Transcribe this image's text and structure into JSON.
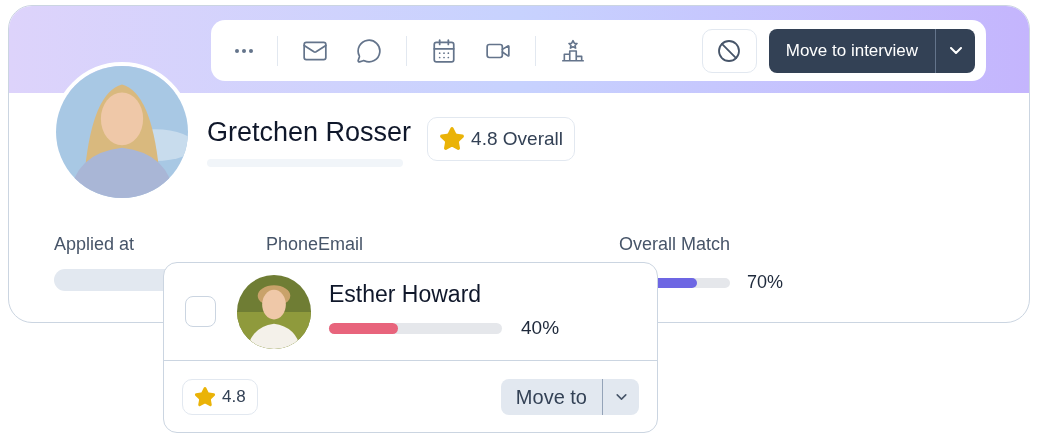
{
  "toolbar": {
    "primary_action": "Move to interview"
  },
  "candidate": {
    "name": "Gretchen Rosser",
    "rating": "4.8 Overall"
  },
  "fields": [
    {
      "label": "Applied at"
    },
    {
      "label": "Phone"
    },
    {
      "label": "Email"
    }
  ],
  "overall_match": {
    "label": "Overall Match",
    "level": 0.7,
    "reading": "70%"
  },
  "popup": {
    "checked": false,
    "name": "Esther Howard",
    "level": 0.4,
    "reading": "40%",
    "rating": "4.8",
    "action": "Move to"
  }
}
